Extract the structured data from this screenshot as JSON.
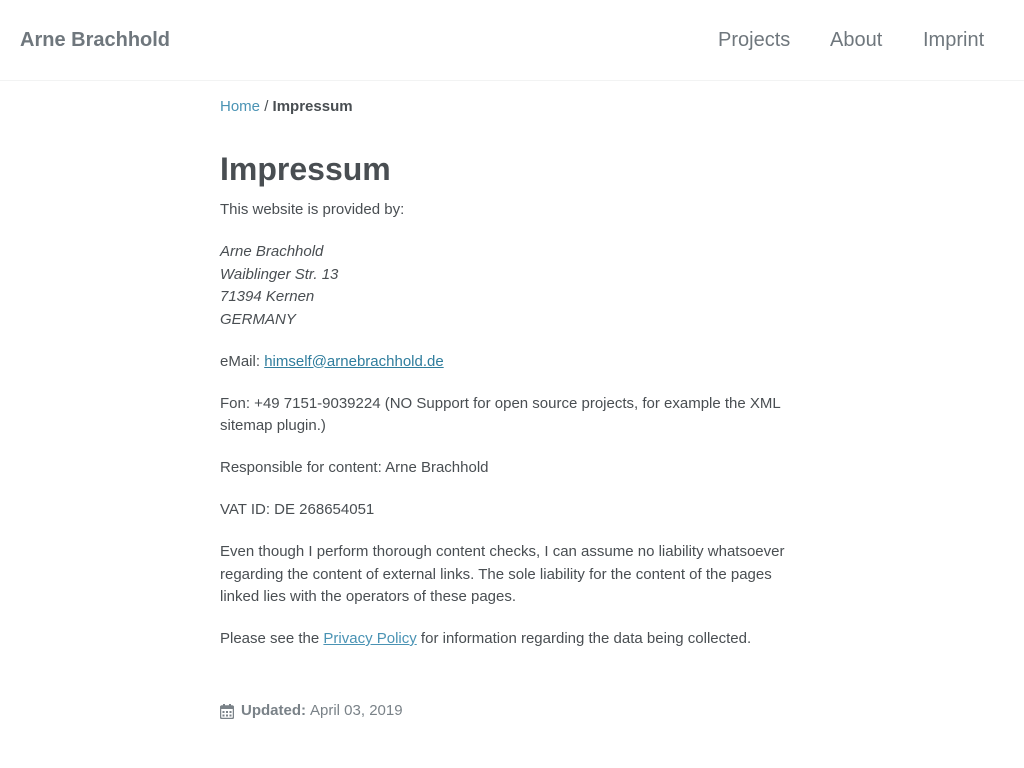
{
  "header": {
    "site_title": "Arne Brachhold",
    "nav": [
      {
        "label": "Projects"
      },
      {
        "label": "About"
      },
      {
        "label": "Imprint"
      }
    ]
  },
  "breadcrumb": {
    "home": "Home",
    "separator": "/",
    "current": "Impressum"
  },
  "page": {
    "title": "Impressum",
    "intro": "This website is provided by:",
    "address": {
      "name": "Arne Brachhold",
      "street": "Waiblinger Str. 13",
      "city": "71394 Kernen",
      "country": "GERMANY"
    },
    "email_label": "eMail: ",
    "email": "himself@arnebrachhold.de",
    "phone": "Fon: +49 7151-9039224 (NO Support for open source projects, for example the XML sitemap plugin.)",
    "responsible": "Responsible for content: Arne Brachhold",
    "vat": "VAT ID: DE 268654051",
    "disclaimer": "Even though I perform thorough content checks, I can assume no liability whatsoever regarding the content of external links. The sole liability for the content of the pages linked lies with the operators of these pages.",
    "privacy_prefix": "Please see the ",
    "privacy_link": "Privacy Policy",
    "privacy_suffix": " for information regarding the data being collected."
  },
  "footer_meta": {
    "icon": "calendar-icon",
    "updated_label": "Updated:",
    "updated_date": "April 03, 2019"
  },
  "colors": {
    "link": "#4a93b4",
    "text": "#494e52",
    "muted": "#6f777d"
  }
}
